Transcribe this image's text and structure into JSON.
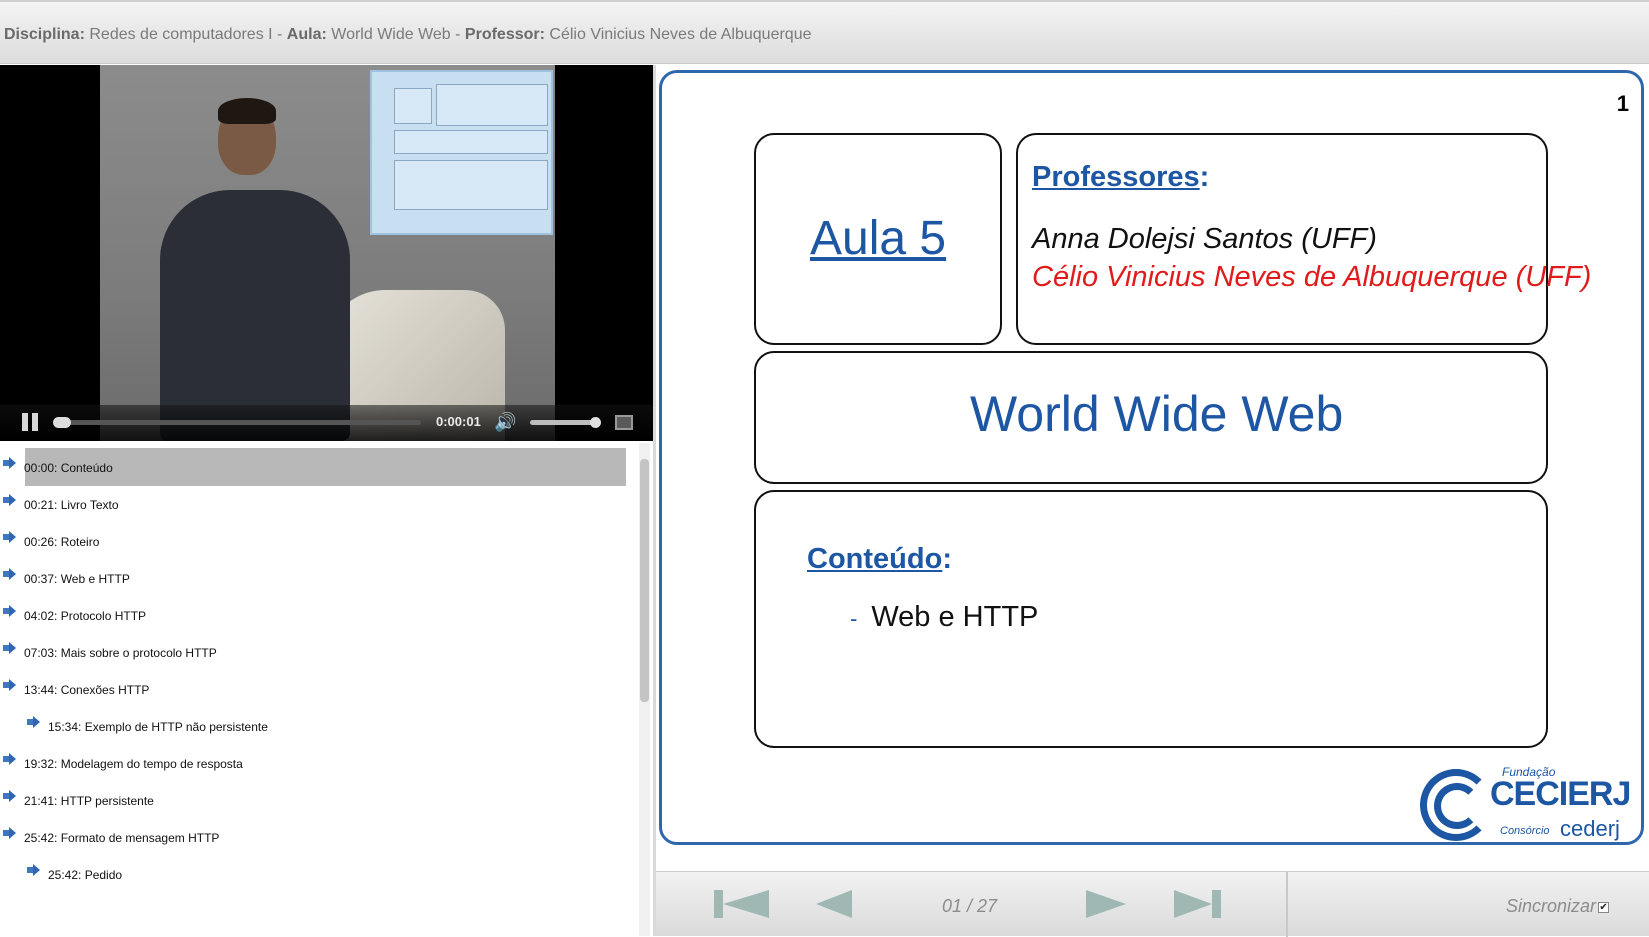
{
  "header": {
    "disciplina_label": "Disciplina:",
    "disciplina_value": "Redes de computadores I",
    "sep1": " - ",
    "aula_label": "Aula:",
    "aula_value": "World Wide Web",
    "sep2": " - ",
    "professor_label": "Professor:",
    "professor_value": "Célio Vinicius Neves de Albuquerque"
  },
  "player": {
    "time": "0:00:01",
    "progress": 0.0,
    "volume": 0.9,
    "icons": [
      "pause-icon",
      "volume-icon",
      "fullscreen-icon"
    ]
  },
  "chapters": [
    {
      "label": "00:00: Conteúdo",
      "indent": 0,
      "active": true
    },
    {
      "label": "00:21: Livro Texto",
      "indent": 0,
      "active": false
    },
    {
      "label": "00:26: Roteiro",
      "indent": 0,
      "active": false
    },
    {
      "label": "00:37: Web e HTTP",
      "indent": 0,
      "active": false
    },
    {
      "label": "04:02: Protocolo HTTP",
      "indent": 0,
      "active": false
    },
    {
      "label": "07:03: Mais sobre o protocolo HTTP",
      "indent": 0,
      "active": false
    },
    {
      "label": "13:44: Conexões HTTP",
      "indent": 0,
      "active": false
    },
    {
      "label": "15:34: Exemplo de HTTP não persistente",
      "indent": 1,
      "active": false
    },
    {
      "label": "19:32: Modelagem do tempo de resposta",
      "indent": 0,
      "active": false
    },
    {
      "label": "21:41: HTTP persistente",
      "indent": 0,
      "active": false
    },
    {
      "label": "25:42: Formato de mensagem HTTP",
      "indent": 0,
      "active": false
    },
    {
      "label": "25:42: Pedido",
      "indent": 1,
      "active": false
    }
  ],
  "slide": {
    "number": "1",
    "aula": "Aula 5",
    "professores_title": "Professores",
    "colon": ":",
    "professor_1": "Anna Dolejsi Santos (UFF)",
    "professor_2": "Célio Vinicius Neves de Albuquerque (UFF)",
    "title": "World Wide Web",
    "conteudo_title": "Conteúdo",
    "conteudo_dash": "-",
    "conteudo_item": "Web e HTTP",
    "logo": {
      "fundacao": "Fundação",
      "name": "CECIERJ",
      "consorcio": "Consórcio",
      "cederj": "cederj"
    },
    "colors": {
      "blue": "#1d56a3",
      "red": "#e01b1b"
    }
  },
  "nav": {
    "page": "01 / 27",
    "sync_label": "Sincronizar",
    "sync_checked": "✔",
    "icons": [
      "first-icon",
      "prev-icon",
      "next-icon",
      "last-icon"
    ]
  }
}
